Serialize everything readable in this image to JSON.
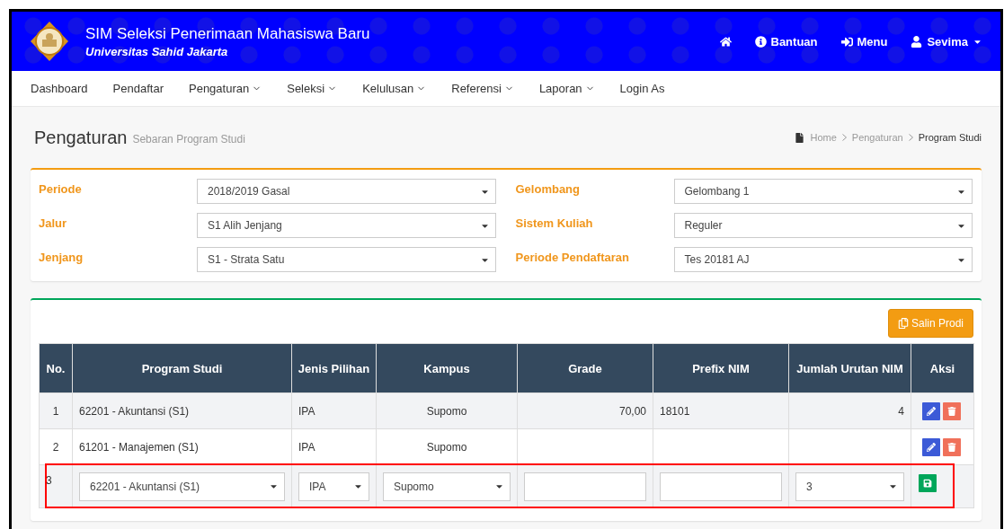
{
  "header": {
    "title": "SIM Seleksi Penerimaan Mahasiswa Baru",
    "subtitle": "Universitas Sahid Jakarta",
    "links": [
      {
        "kind": "home"
      },
      {
        "kind": "help",
        "label": "Bantuan"
      },
      {
        "kind": "menu",
        "label": "Menu"
      },
      {
        "kind": "user",
        "label": "Sevima"
      }
    ]
  },
  "nav": [
    {
      "label": "Dashboard",
      "dropdown": false
    },
    {
      "label": "Pendaftar",
      "dropdown": false
    },
    {
      "label": "Pengaturan",
      "dropdown": true
    },
    {
      "label": "Seleksi",
      "dropdown": true
    },
    {
      "label": "Kelulusan",
      "dropdown": true
    },
    {
      "label": "Referensi",
      "dropdown": true
    },
    {
      "label": "Laporan",
      "dropdown": true
    },
    {
      "label": "Login As",
      "dropdown": false
    }
  ],
  "page": {
    "title": "Pengaturan",
    "subtitle": "Sebaran Program Studi"
  },
  "breadcrumb": [
    {
      "label": "Home",
      "current": false
    },
    {
      "label": "Pengaturan",
      "current": false
    },
    {
      "label": "Program Studi",
      "current": true
    }
  ],
  "filters": [
    {
      "label": "Periode",
      "value": "2018/2019 Gasal"
    },
    {
      "label": "Gelombang",
      "value": "Gelombang 1"
    },
    {
      "label": "Jalur",
      "value": "S1 Alih Jenjang"
    },
    {
      "label": "Sistem Kuliah",
      "value": "Reguler"
    },
    {
      "label": "Jenjang",
      "value": "S1 - Strata Satu"
    },
    {
      "label": "Periode Pendaftaran",
      "value": "Tes 20181 AJ"
    }
  ],
  "copy_button": "Salin Prodi",
  "table": {
    "columns": [
      "No.",
      "Program Studi",
      "Jenis Pilihan",
      "Kampus",
      "Grade",
      "Prefix NIM",
      "Jumlah Urutan NIM",
      "Aksi"
    ],
    "rows": [
      {
        "kind": "view",
        "no": "1",
        "program": "62201 - Akuntansi (S1)",
        "jenis": "IPA",
        "kampus": "Supomo",
        "grade": "70,00",
        "prefix": "18101",
        "jumlah": "4"
      },
      {
        "kind": "view",
        "no": "2",
        "program": "61201 - Manajemen (S1)",
        "jenis": "IPA",
        "kampus": "Supomo"
      },
      {
        "kind": "edit",
        "highlighted": true,
        "no": "3",
        "program": "62201 - Akuntansi (S1)",
        "jenis": "IPA",
        "kampus": "Supomo",
        "jumlah": "3"
      }
    ]
  }
}
